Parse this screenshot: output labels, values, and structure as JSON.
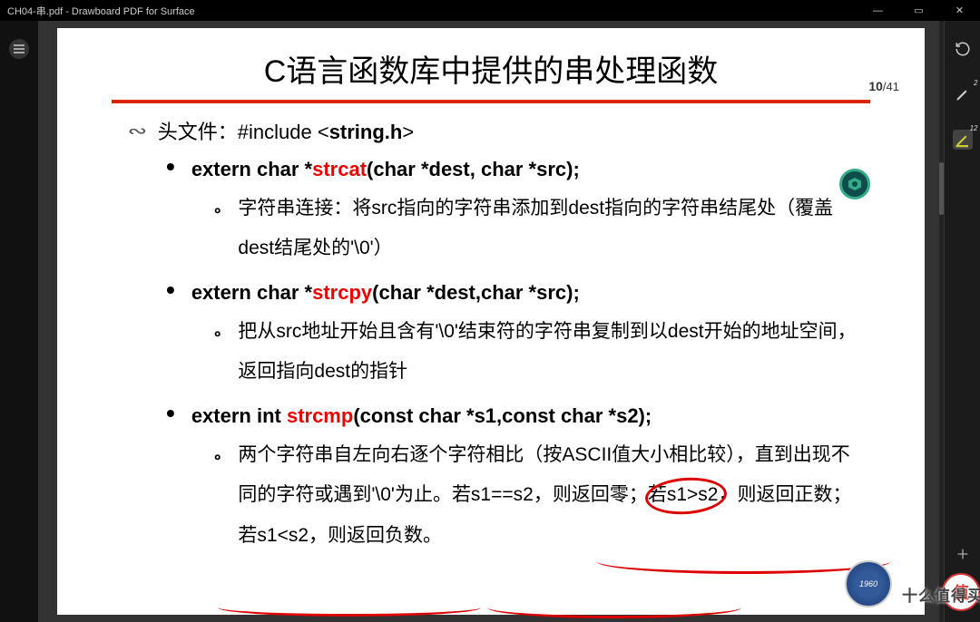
{
  "window": {
    "title": "CH04-串.pdf - Drawboard PDF for Surface",
    "ctrl_min": "—",
    "ctrl_max": "▭",
    "ctrl_close": "✕"
  },
  "page_indicator": {
    "current": "10",
    "total": "/41"
  },
  "doc": {
    "title": "C语言函数库中提供的串处理函数",
    "header_line": "头文件：#include <string.h>",
    "items": [
      {
        "sig_pre": "extern char *",
        "fn": "strcat",
        "sig_post": "(char *dest, char *src);",
        "desc": "字符串连接：将src指向的字符串添加到dest指向的字符串结尾处（覆盖dest结尾处的'\\0'）"
      },
      {
        "sig_pre": "extern char *",
        "fn": "strcpy",
        "sig_post": "(char *dest,char *src);",
        "desc": "把从src地址开始且含有'\\0'结束符的字符串复制到以dest开始的地址空间，返回指向dest的指针"
      },
      {
        "sig_pre": "extern int ",
        "fn": "strcmp",
        "sig_post": "(const char *s1,const char *s2);",
        "desc": "两个字符串自左向右逐个字符相比（按ASCII值大小相比较），直到出现不同的字符或遇到'\\0'为止。若s1==s2，则返回零；若s1>s2，则返回正数；若s1<s2，则返回负数。"
      }
    ]
  },
  "tools": {
    "badge1": "2",
    "badge2": "12"
  },
  "watermark": {
    "badge": "值",
    "text": "十么值得买"
  },
  "stamp_year": "1960"
}
